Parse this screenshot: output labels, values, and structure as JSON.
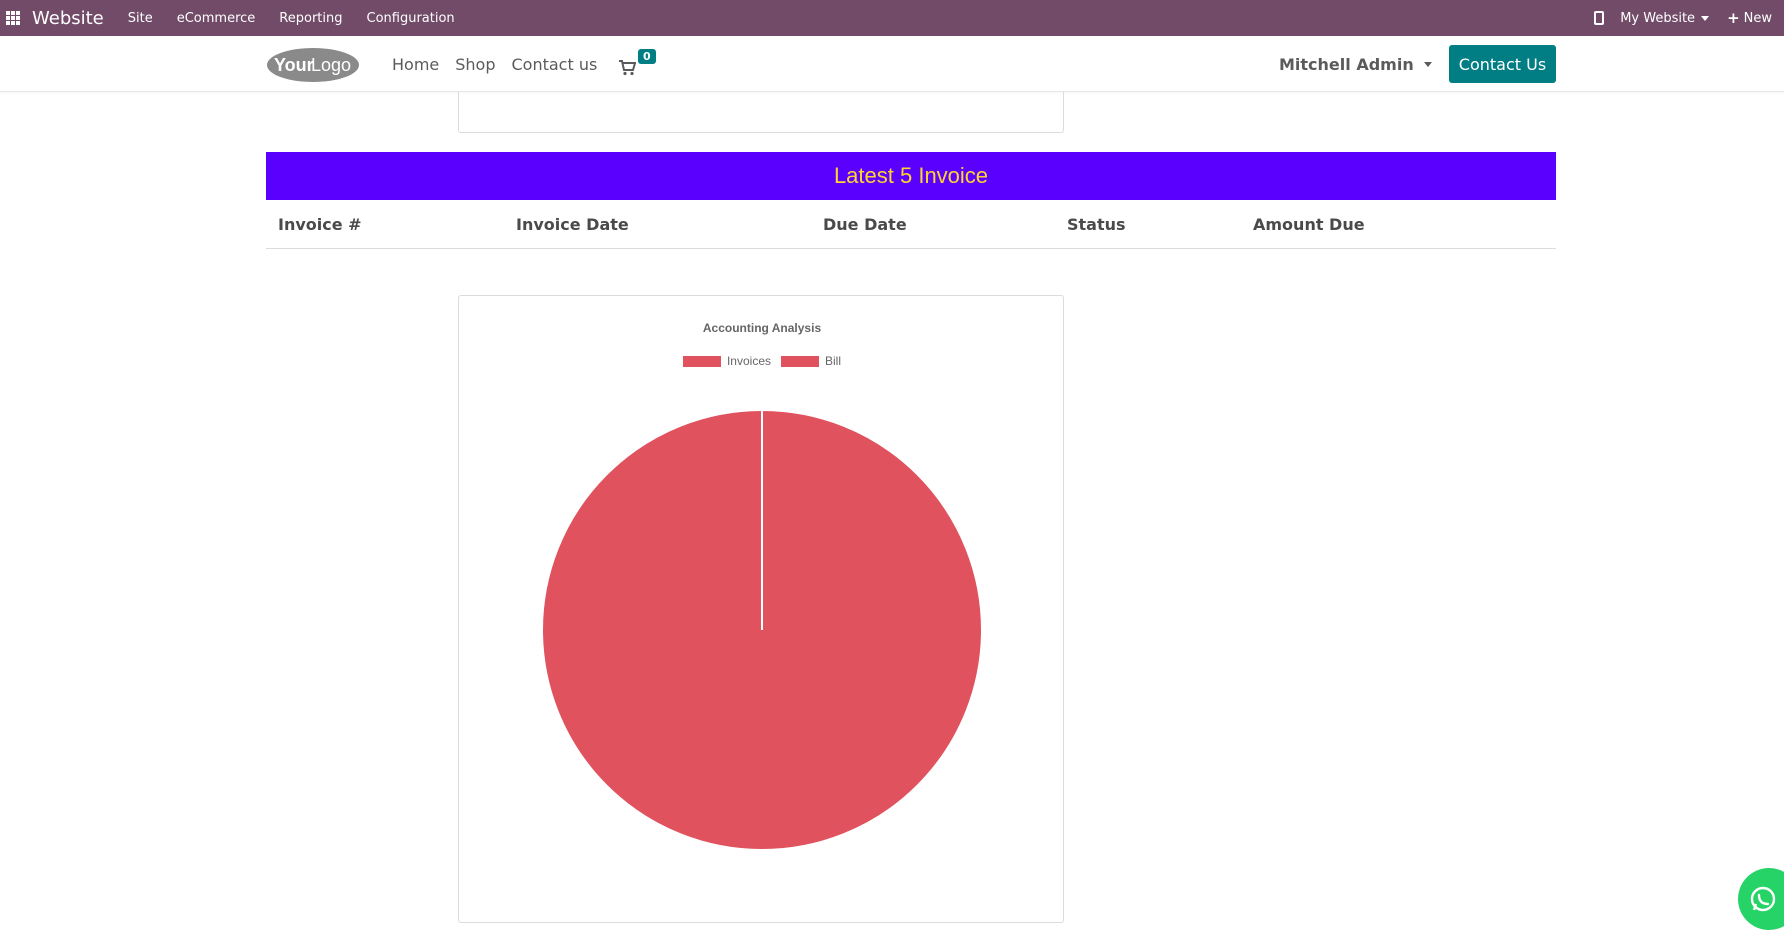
{
  "adminbar": {
    "brand": "Website",
    "menu": [
      "Site",
      "eCommerce",
      "Reporting",
      "Configuration"
    ],
    "my_website": "My Website",
    "new_label": "New"
  },
  "header": {
    "logo_text_bold": "Your",
    "logo_text_light": "Logo",
    "nav": [
      "Home",
      "Shop",
      "Contact us"
    ],
    "cart_count": "0",
    "user_name": "Mitchell Admin",
    "contact_button": "Contact Us"
  },
  "invoices": {
    "title": "Latest 5 Invoice",
    "columns": [
      "Invoice #",
      "Invoice Date",
      "Due Date",
      "Status",
      "Amount Due"
    ],
    "rows": []
  },
  "colors": {
    "adminbar": "#714b67",
    "banner": "#5a00ff",
    "banner_text": "#ffd230",
    "accent": "#017e84",
    "pie": "#e0525d"
  },
  "chart_data": {
    "type": "pie",
    "title": "Accounting Analysis",
    "labels": [
      "Invoices",
      "Bill"
    ],
    "values": [
      0,
      100
    ],
    "colors": [
      "#e0525d",
      "#e0525d"
    ],
    "legend": "top"
  }
}
